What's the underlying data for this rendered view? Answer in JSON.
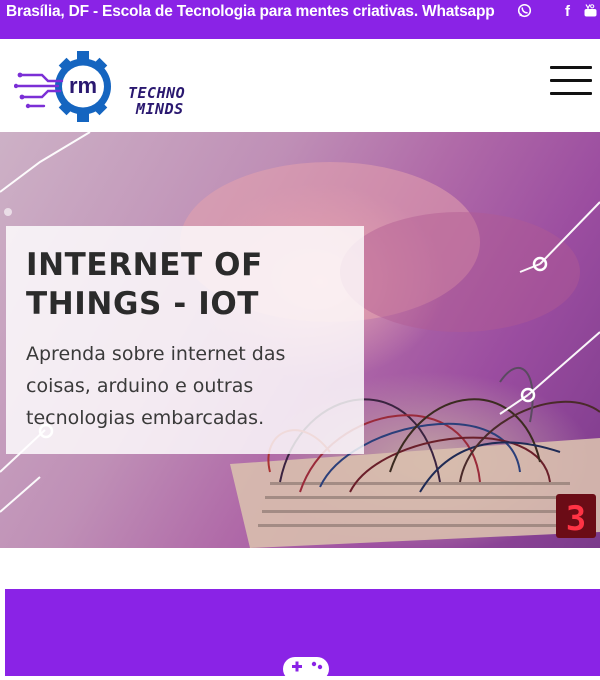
{
  "topbar": {
    "text": "Brasília, DF - Escola de Tecnologia para mentes criativas.  Whatsapp",
    "icons": [
      "whatsapp-icon",
      "facebook-icon",
      "youtube-icon"
    ],
    "facebook_glyph": "f"
  },
  "header": {
    "logo": {
      "monogram": "rm",
      "line1": "TECHNO",
      "line2": "MINDS"
    },
    "menu_icon": "hamburger-icon"
  },
  "hero": {
    "title": "INTERNET OF THINGS - IOT",
    "description": "Aprenda sobre internet das coisas, arduino e outras tecnologias embarcadas.",
    "display_digit": "3"
  },
  "promo": {
    "icon": "gamepad-icon"
  },
  "colors": {
    "brand_purple": "#8a23e6",
    "logo_blue": "#1565c0",
    "logo_navy": "#2a1870",
    "text_dark": "#2b2b2b"
  }
}
